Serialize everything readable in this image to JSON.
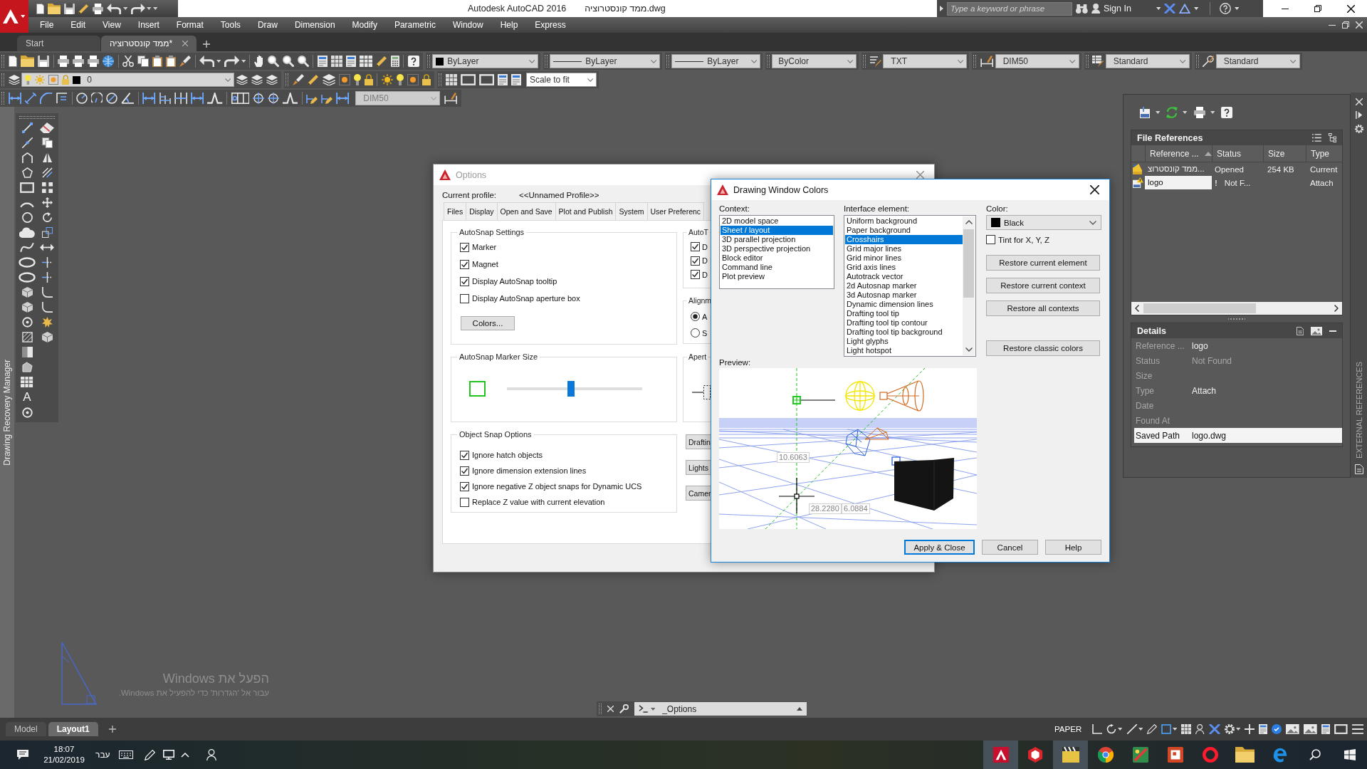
{
  "title_bar": {
    "app_title": "Autodesk AutoCAD 2016",
    "file_name": "ממד קונסטרוציה.dwg",
    "search": {
      "placeholder": "Type a keyword or phrase"
    },
    "sign_in": "Sign In"
  },
  "menu_bar": [
    "File",
    "Edit",
    "View",
    "Insert",
    "Format",
    "Tools",
    "Draw",
    "Dimension",
    "Modify",
    "Parametric",
    "Window",
    "Help",
    "Express"
  ],
  "document_tabs": [
    {
      "label": "Start",
      "selected": false,
      "closable": false
    },
    {
      "label": "ממד קונסטרוציה*",
      "selected": true,
      "closable": true
    }
  ],
  "toolbars": {
    "properties": [
      {
        "kind": "color",
        "value": "ByLayer",
        "color": "#000000"
      },
      {
        "kind": "linetype",
        "value": "ByLayer"
      },
      {
        "kind": "lineweight",
        "value": "ByLayer"
      },
      {
        "kind": "plot_style",
        "value": "ByColor"
      },
      {
        "kind": "text_style",
        "value": "TXT"
      },
      {
        "kind": "dim_style",
        "value": "DIM50"
      },
      {
        "kind": "table_style",
        "value": "Standard"
      },
      {
        "kind": "multileader_style",
        "value": "Standard"
      }
    ],
    "layer": {
      "value": "0",
      "color": "#000000"
    },
    "viewport_scale": "Scale to fit",
    "dimension_style": {
      "value": "DIM50",
      "disabled": true
    }
  },
  "side_panel": {
    "title": "Drawing Recovery Manager"
  },
  "draw_toolbar": {
    "text_tool": "A"
  },
  "activation_notice": {
    "title": "הפעל את Windows",
    "hint": "עבור אל 'הגדרות' כדי להפעיל את Windows."
  },
  "options_dialog": {
    "title": "Options",
    "active": false,
    "profile_label": "Current profile:",
    "profile": "<<Unnamed Profile>>",
    "tabs": [
      {
        "label": "Files",
        "selected": false
      },
      {
        "label": "Display",
        "selected": false
      },
      {
        "label": "Open and Save",
        "selected": false
      },
      {
        "label": "Plot and Publish",
        "selected": false
      },
      {
        "label": "System",
        "selected": false
      },
      {
        "label": "User Preferenc",
        "selected": false
      }
    ],
    "autosnap_settings": {
      "title": "AutoSnap Settings",
      "options": [
        {
          "label": "Marker",
          "checked": true
        },
        {
          "label": "Magnet",
          "checked": true
        },
        {
          "label": "Display AutoSnap tooltip",
          "checked": true
        },
        {
          "label": "Display AutoSnap aperture box",
          "checked": false
        }
      ],
      "colors_button": "Colors..."
    },
    "marker_size": {
      "title": "AutoSnap Marker Size",
      "level": 0.47
    },
    "object_snap_options": {
      "title": "Object Snap Options",
      "options": [
        {
          "label": "Ignore hatch objects",
          "checked": true
        },
        {
          "label": "Ignore dimension extension lines",
          "checked": true
        },
        {
          "label": "Ignore negative Z object snaps for Dynamic UCS",
          "checked": true
        },
        {
          "label": "Replace Z value with current elevation",
          "checked": false
        }
      ]
    },
    "autotrack_settings": {
      "title": "AutoT",
      "options": [
        {
          "label": "D",
          "checked": true
        },
        {
          "label": "D",
          "checked": true
        },
        {
          "label": "D",
          "checked": true
        }
      ]
    },
    "alignment": {
      "title": "Alignm",
      "choices": [
        {
          "label": "A",
          "selected": true
        },
        {
          "label": "S",
          "selected": false
        }
      ]
    },
    "aperture_size": {
      "title": "Apert"
    },
    "buttons": [
      "Draftin",
      "Lights",
      "Camer"
    ]
  },
  "colors_dialog": {
    "title": "Drawing Window Colors",
    "active": true,
    "context_label": "Context:",
    "contexts": [
      {
        "label": "2D model space",
        "selected": false
      },
      {
        "label": "Sheet / layout",
        "selected": true
      },
      {
        "label": "3D parallel projection",
        "selected": false
      },
      {
        "label": "3D perspective projection",
        "selected": false
      },
      {
        "label": "Block editor",
        "selected": false
      },
      {
        "label": "Command line",
        "selected": false
      },
      {
        "label": "Plot preview",
        "selected": false
      }
    ],
    "element_label": "Interface element:",
    "elements": [
      {
        "label": "Uniform background",
        "selected": false
      },
      {
        "label": "Paper background",
        "selected": false
      },
      {
        "label": "Crosshairs",
        "selected": true
      },
      {
        "label": "Grid major lines",
        "selected": false
      },
      {
        "label": "Grid minor lines",
        "selected": false
      },
      {
        "label": "Grid axis lines",
        "selected": false
      },
      {
        "label": "Autotrack vector",
        "selected": false
      },
      {
        "label": "2d Autosnap marker",
        "selected": false
      },
      {
        "label": "3d Autosnap marker",
        "selected": false
      },
      {
        "label": "Dynamic dimension lines",
        "selected": false
      },
      {
        "label": "Drafting tool tip",
        "selected": false
      },
      {
        "label": "Drafting tool tip contour",
        "selected": false
      },
      {
        "label": "Drafting tool tip background",
        "selected": false
      },
      {
        "label": "Light glyphs",
        "selected": false
      },
      {
        "label": "Light hotspot",
        "selected": false
      }
    ],
    "color_label": "Color:",
    "color": {
      "value": "Black",
      "color": "#000000"
    },
    "tint": {
      "label": "Tint for X, Y, Z",
      "checked": false
    },
    "restore_buttons": [
      "Restore current element",
      "Restore current context",
      "Restore all contexts",
      "Restore classic colors"
    ],
    "preview_label": "Preview:",
    "preview_values": [
      "10.6063",
      "28.2280",
      "6.0884"
    ],
    "buttons": [
      {
        "label": "Apply & Close",
        "default": true
      },
      {
        "label": "Cancel",
        "default": false
      },
      {
        "label": "Help",
        "default": false
      }
    ]
  },
  "xref_palette": {
    "header": "File References",
    "columns": [
      {
        "label": "Reference ...",
        "sorted": true
      },
      {
        "label": "Status",
        "sorted": false
      },
      {
        "label": "Size",
        "sorted": false
      },
      {
        "label": "Type",
        "sorted": false
      }
    ],
    "rows": [
      {
        "kind": "current",
        "name": "ממד קונסטרוצ...",
        "status": "Opened",
        "size": "254 KB",
        "type": "Current",
        "selected": false
      },
      {
        "kind": "missing",
        "name": "logo",
        "flag": "!",
        "status": "Not F...",
        "type": "Attach",
        "selected": true
      }
    ],
    "details_header": "Details",
    "details": [
      {
        "label": "Reference ...",
        "value": {
          "text": "logo",
          "disabled": false
        },
        "selected": false
      },
      {
        "label": "Status",
        "value": {
          "text": "Not Found",
          "disabled": true
        },
        "selected": false
      },
      {
        "label": "Size",
        "selected": false
      },
      {
        "label": "Type",
        "value": {
          "text": "Attach",
          "disabled": false
        },
        "selected": false
      },
      {
        "label": "Date",
        "selected": false
      },
      {
        "label": "Found At",
        "selected": false
      },
      {
        "label": "Saved Path",
        "value": {
          "text": "logo.dwg",
          "disabled": false
        },
        "selected": true
      }
    ],
    "strip_title": "EXTERNAL REFERENCES"
  },
  "command_line": {
    "value": "_Options"
  },
  "layout_tabs": [
    {
      "label": "Model",
      "selected": false
    },
    {
      "label": "Layout1",
      "selected": true
    }
  ],
  "status_bar": {
    "space": "PAPER"
  },
  "taskbar": {
    "time": "18:07",
    "date": "21/02/2019",
    "language": "עבר",
    "apps": [
      {
        "active": true
      },
      {
        "active": false
      },
      {
        "active": true
      },
      {
        "active": false
      },
      {
        "active": false
      },
      {
        "active": false
      },
      {
        "active": false
      },
      {
        "active": false
      },
      {
        "active": false
      }
    ]
  }
}
